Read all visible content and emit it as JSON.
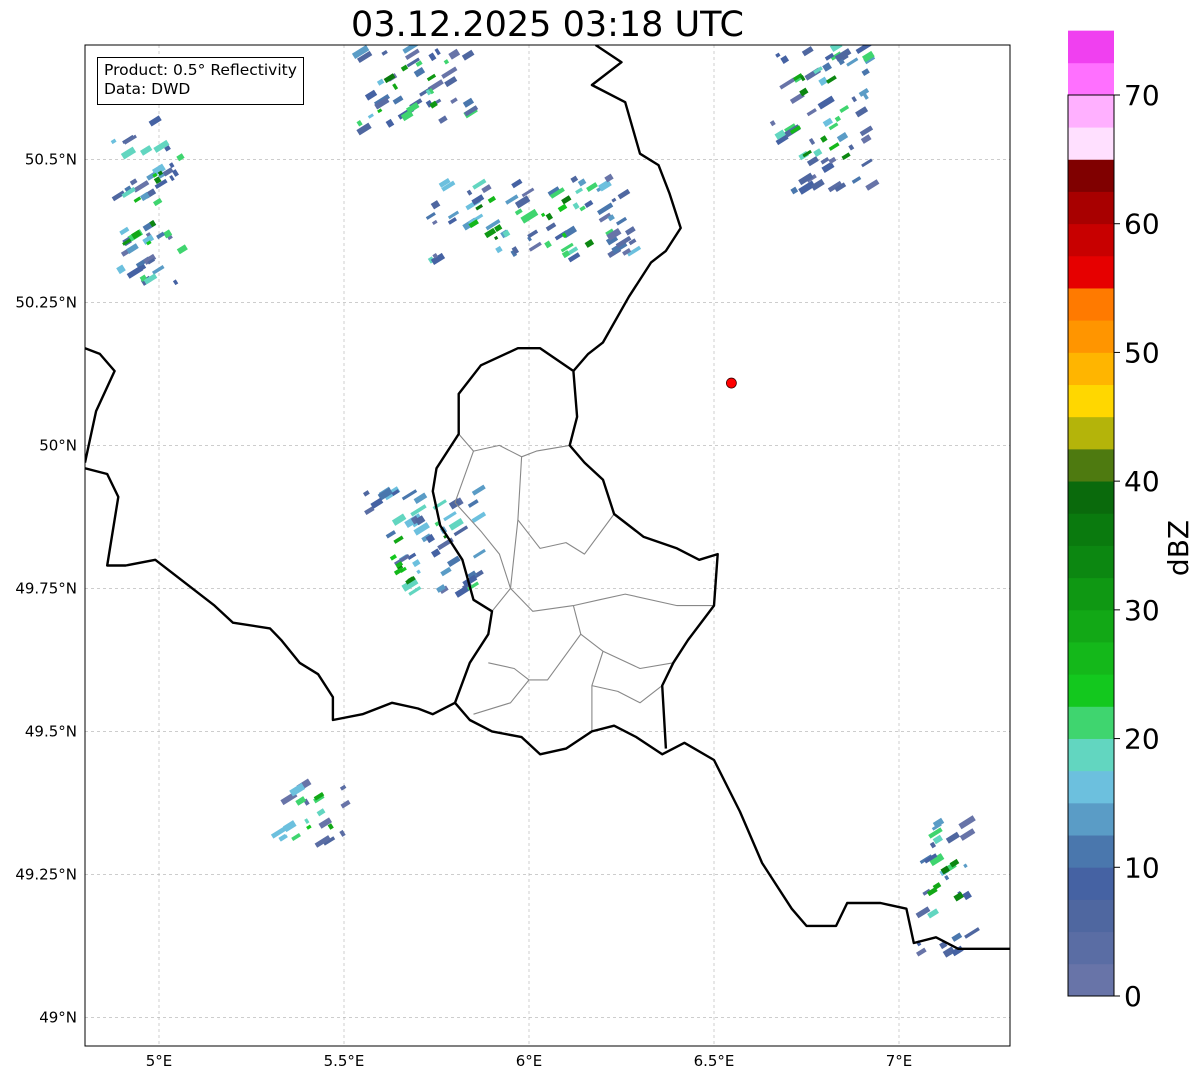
{
  "title": "03.12.2025 03:18 UTC",
  "info": {
    "product": "Product: 0.5° Reflectivity",
    "source": "Data: DWD"
  },
  "map": {
    "lon_range": [
      4.8,
      7.3
    ],
    "lat_range": [
      48.95,
      50.7
    ],
    "lon_ticks": [
      {
        "value": 5.0,
        "label": "5°E"
      },
      {
        "value": 5.5,
        "label": "5.5°E"
      },
      {
        "value": 6.0,
        "label": "6°E"
      },
      {
        "value": 6.5,
        "label": "6.5°E"
      },
      {
        "value": 7.0,
        "label": "7°E"
      }
    ],
    "lat_ticks": [
      {
        "value": 49.0,
        "label": "49°N"
      },
      {
        "value": 49.25,
        "label": "49.25°N"
      },
      {
        "value": 49.5,
        "label": "49.5°N"
      },
      {
        "value": 49.75,
        "label": "49.75°N"
      },
      {
        "value": 50.0,
        "label": "50°N"
      },
      {
        "value": 50.25,
        "label": "50.25°N"
      },
      {
        "value": 50.5,
        "label": "50.5°N"
      }
    ],
    "gridlines": true,
    "radar_site": {
      "lon": 6.547,
      "lat": 50.109,
      "color": "#ff0000"
    },
    "borders": [
      [
        [
          4.8,
          50.17
        ],
        [
          4.84,
          50.16
        ],
        [
          4.88,
          50.13
        ],
        [
          4.83,
          50.06
        ],
        [
          4.81,
          50.0
        ],
        [
          4.8,
          49.97
        ]
      ],
      [
        [
          4.8,
          49.96
        ],
        [
          4.86,
          49.95
        ],
        [
          4.89,
          49.91
        ],
        [
          4.86,
          49.79
        ],
        [
          4.91,
          49.79
        ],
        [
          4.99,
          49.8
        ],
        [
          5.07,
          49.76
        ],
        [
          5.15,
          49.72
        ],
        [
          5.2,
          49.69
        ],
        [
          5.3,
          49.68
        ],
        [
          5.33,
          49.66
        ],
        [
          5.38,
          49.62
        ],
        [
          5.43,
          49.6
        ],
        [
          5.47,
          49.56
        ],
        [
          5.47,
          49.52
        ],
        [
          5.55,
          49.53
        ],
        [
          5.63,
          49.55
        ],
        [
          5.7,
          49.54
        ],
        [
          5.74,
          49.53
        ],
        [
          5.8,
          49.55
        ],
        [
          5.84,
          49.52
        ],
        [
          5.9,
          49.5
        ],
        [
          5.98,
          49.49
        ],
        [
          6.03,
          49.46
        ],
        [
          6.1,
          49.47
        ],
        [
          6.17,
          49.5
        ],
        [
          6.23,
          49.51
        ],
        [
          6.29,
          49.49
        ],
        [
          6.36,
          49.46
        ],
        [
          6.42,
          49.48
        ],
        [
          6.5,
          49.45
        ],
        [
          6.57,
          49.36
        ],
        [
          6.59,
          49.33
        ],
        [
          6.63,
          49.27
        ],
        [
          6.71,
          49.19
        ],
        [
          6.75,
          49.16
        ],
        [
          6.83,
          49.16
        ],
        [
          6.86,
          49.2
        ],
        [
          6.95,
          49.2
        ],
        [
          7.02,
          49.19
        ],
        [
          7.04,
          49.13
        ],
        [
          7.1,
          49.14
        ],
        [
          7.16,
          49.12
        ],
        [
          7.22,
          49.12
        ],
        [
          7.3,
          49.12
        ]
      ],
      [
        [
          5.8,
          49.55
        ],
        [
          5.84,
          49.62
        ],
        [
          5.89,
          49.67
        ],
        [
          5.9,
          49.71
        ],
        [
          5.85,
          49.73
        ],
        [
          5.82,
          49.8
        ],
        [
          5.76,
          49.86
        ],
        [
          5.74,
          49.92
        ],
        [
          5.75,
          49.96
        ],
        [
          5.81,
          50.02
        ],
        [
          5.81,
          50.09
        ],
        [
          5.87,
          50.14
        ],
        [
          5.97,
          50.17
        ],
        [
          6.03,
          50.17
        ],
        [
          6.12,
          50.13
        ],
        [
          6.13,
          50.05
        ],
        [
          6.11,
          50.0
        ],
        [
          6.15,
          49.97
        ],
        [
          6.2,
          49.94
        ],
        [
          6.23,
          49.88
        ],
        [
          6.31,
          49.84
        ],
        [
          6.4,
          49.82
        ],
        [
          6.46,
          49.8
        ],
        [
          6.51,
          49.81
        ],
        [
          6.5,
          49.72
        ],
        [
          6.43,
          49.66
        ],
        [
          6.39,
          49.62
        ],
        [
          6.36,
          49.58
        ],
        [
          6.37,
          49.47
        ]
      ],
      [
        [
          6.12,
          50.13
        ],
        [
          6.16,
          50.16
        ],
        [
          6.2,
          50.18
        ],
        [
          6.27,
          50.26
        ],
        [
          6.33,
          50.32
        ],
        [
          6.37,
          50.34
        ],
        [
          6.41,
          50.38
        ],
        [
          6.38,
          50.44
        ],
        [
          6.35,
          50.49
        ],
        [
          6.3,
          50.51
        ],
        [
          6.26,
          50.6
        ],
        [
          6.17,
          50.63
        ],
        [
          6.25,
          50.67
        ],
        [
          6.18,
          50.7
        ]
      ]
    ],
    "districts": [
      [
        [
          5.81,
          50.02
        ],
        [
          5.85,
          49.99
        ],
        [
          5.92,
          50.0
        ],
        [
          5.98,
          49.98
        ],
        [
          6.02,
          49.99
        ],
        [
          6.11,
          50.0
        ]
      ],
      [
        [
          5.85,
          49.99
        ],
        [
          5.8,
          49.9
        ],
        [
          5.87,
          49.85
        ],
        [
          5.92,
          49.81
        ],
        [
          5.95,
          49.75
        ],
        [
          5.9,
          49.71
        ]
      ],
      [
        [
          5.98,
          49.98
        ],
        [
          5.97,
          49.87
        ],
        [
          6.03,
          49.82
        ],
        [
          6.1,
          49.83
        ],
        [
          6.15,
          49.81
        ],
        [
          6.23,
          49.88
        ]
      ],
      [
        [
          5.97,
          49.87
        ],
        [
          5.95,
          49.75
        ],
        [
          6.01,
          49.71
        ],
        [
          6.12,
          49.72
        ],
        [
          6.19,
          49.73
        ],
        [
          6.26,
          49.74
        ],
        [
          6.4,
          49.72
        ],
        [
          6.5,
          49.72
        ]
      ],
      [
        [
          6.12,
          49.72
        ],
        [
          6.14,
          49.67
        ],
        [
          6.2,
          49.64
        ],
        [
          6.17,
          49.58
        ],
        [
          6.17,
          49.5
        ]
      ],
      [
        [
          5.89,
          49.62
        ],
        [
          5.96,
          49.61
        ],
        [
          6.0,
          49.59
        ],
        [
          6.05,
          49.59
        ],
        [
          6.14,
          49.67
        ]
      ],
      [
        [
          6.2,
          49.64
        ],
        [
          6.3,
          49.61
        ],
        [
          6.39,
          49.62
        ]
      ],
      [
        [
          6.0,
          49.59
        ],
        [
          5.95,
          49.55
        ],
        [
          5.85,
          49.53
        ]
      ],
      [
        [
          6.17,
          49.58
        ],
        [
          6.24,
          49.57
        ],
        [
          6.3,
          49.55
        ],
        [
          6.36,
          49.58
        ]
      ]
    ],
    "echo_bands": [
      {
        "lon": [
          4.85,
          5.05
        ],
        "lat": [
          50.28,
          50.57
        ]
      },
      {
        "lon": [
          5.52,
          5.83
        ],
        "lat": [
          50.55,
          50.7
        ]
      },
      {
        "lon": [
          5.72,
          6.27
        ],
        "lat": [
          50.32,
          50.47
        ]
      },
      {
        "lon": [
          6.65,
          6.92
        ],
        "lat": [
          50.44,
          50.7
        ]
      },
      {
        "lon": [
          5.55,
          5.85
        ],
        "lat": [
          49.72,
          49.92
        ]
      },
      {
        "lon": [
          5.3,
          5.5
        ],
        "lat": [
          49.3,
          49.41
        ]
      },
      {
        "lon": [
          7.04,
          7.18
        ],
        "lat": [
          49.1,
          49.35
        ]
      }
    ]
  },
  "colorbar": {
    "label": "dBZ",
    "vmin": 0,
    "vmax": 70,
    "step": 2.5,
    "ticks": [
      "0",
      "10",
      "20",
      "30",
      "40",
      "50",
      "60",
      "70"
    ],
    "colors": [
      "#6874a8",
      "#5a6da4",
      "#4f67a0",
      "#4562a3",
      "#4a77ad",
      "#5a9cc6",
      "#6cc0de",
      "#62d6c0",
      "#3fd56f",
      "#13c81e",
      "#14b81a",
      "#12a816",
      "#0f9813",
      "#0c8711",
      "#0a7a0e",
      "#0a6a0c",
      "#4e7a10",
      "#b4b40a",
      "#ffd700",
      "#ffb500",
      "#ff9500",
      "#ff7a00",
      "#e60000",
      "#c80000",
      "#a80000",
      "#800000",
      "#ffe0ff",
      "#ffb0ff",
      "#ff70ff",
      "#f040f0"
    ]
  }
}
